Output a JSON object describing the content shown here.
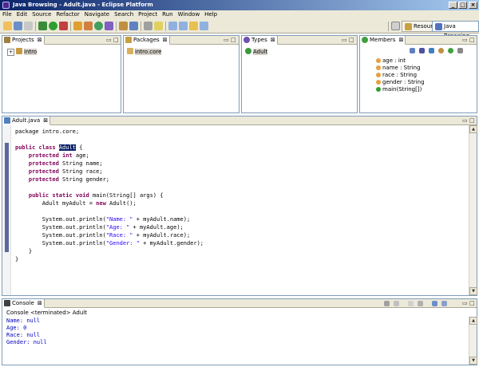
{
  "window": {
    "title": "Java Browsing - Adult.java - Eclipse Platform"
  },
  "menu": [
    "File",
    "Edit",
    "Source",
    "Refactor",
    "Navigate",
    "Search",
    "Project",
    "Run",
    "Window",
    "Help"
  ],
  "perspectives": {
    "resource": "Resource",
    "java_browsing": "Java Browsing"
  },
  "panes": {
    "projects": {
      "tab": "Projects",
      "items": [
        "intro"
      ]
    },
    "packages": {
      "tab": "Packages",
      "items": [
        "intro.core"
      ]
    },
    "types": {
      "tab": "Types",
      "items": [
        "Adult"
      ]
    },
    "members": {
      "tab": "Members",
      "items": [
        "age : int",
        "name : String",
        "race : String",
        "gender : String",
        "main(String[])"
      ]
    }
  },
  "editor": {
    "tab": "Adult.java",
    "lines": [
      [
        [
          "package intro.core;",
          ""
        ]
      ],
      [
        [
          "",
          ""
        ]
      ],
      [
        [
          "public class ",
          "kw"
        ],
        [
          "Adult",
          "sel"
        ],
        [
          " {",
          ""
        ]
      ],
      [
        [
          "    protected int ",
          "kw"
        ],
        [
          "age;",
          ""
        ]
      ],
      [
        [
          "    protected ",
          "kw"
        ],
        [
          "String name;",
          ""
        ]
      ],
      [
        [
          "    protected ",
          "kw"
        ],
        [
          "String race;",
          ""
        ]
      ],
      [
        [
          "    protected ",
          "kw"
        ],
        [
          "String gender;",
          ""
        ]
      ],
      [
        [
          "",
          ""
        ]
      ],
      [
        [
          "    public static void ",
          "kw"
        ],
        [
          "main(String[] args) {",
          ""
        ]
      ],
      [
        [
          "        Adult myAdult = ",
          ""
        ],
        [
          "new ",
          "kw"
        ],
        [
          "Adult();",
          ""
        ]
      ],
      [
        [
          "",
          ""
        ]
      ],
      [
        [
          "        System.out.println(",
          ""
        ],
        [
          "\"Name: \"",
          "str"
        ],
        [
          " + myAdult.name);",
          ""
        ]
      ],
      [
        [
          "        System.out.println(",
          ""
        ],
        [
          "\"Age: \"",
          "str"
        ],
        [
          " + myAdult.age);",
          ""
        ]
      ],
      [
        [
          "        System.out.println(",
          ""
        ],
        [
          "\"Race: \"",
          "str"
        ],
        [
          " + myAdult.race);",
          ""
        ]
      ],
      [
        [
          "        System.out.println(",
          ""
        ],
        [
          "\"Gender: \"",
          "str"
        ],
        [
          " + myAdult.gender);",
          ""
        ]
      ],
      [
        [
          "    }",
          ""
        ]
      ],
      [
        [
          "}",
          ""
        ]
      ]
    ]
  },
  "console": {
    "tab": "Console",
    "status": "Console <terminated> Adult",
    "output": [
      "Name: null",
      "Age: 0",
      "Race: null",
      "Gender: null"
    ]
  },
  "colors": {
    "keyword": "#7f0055",
    "string": "#2a00ff",
    "console_text": "#0000c0",
    "titlebar": "#0a246a"
  }
}
